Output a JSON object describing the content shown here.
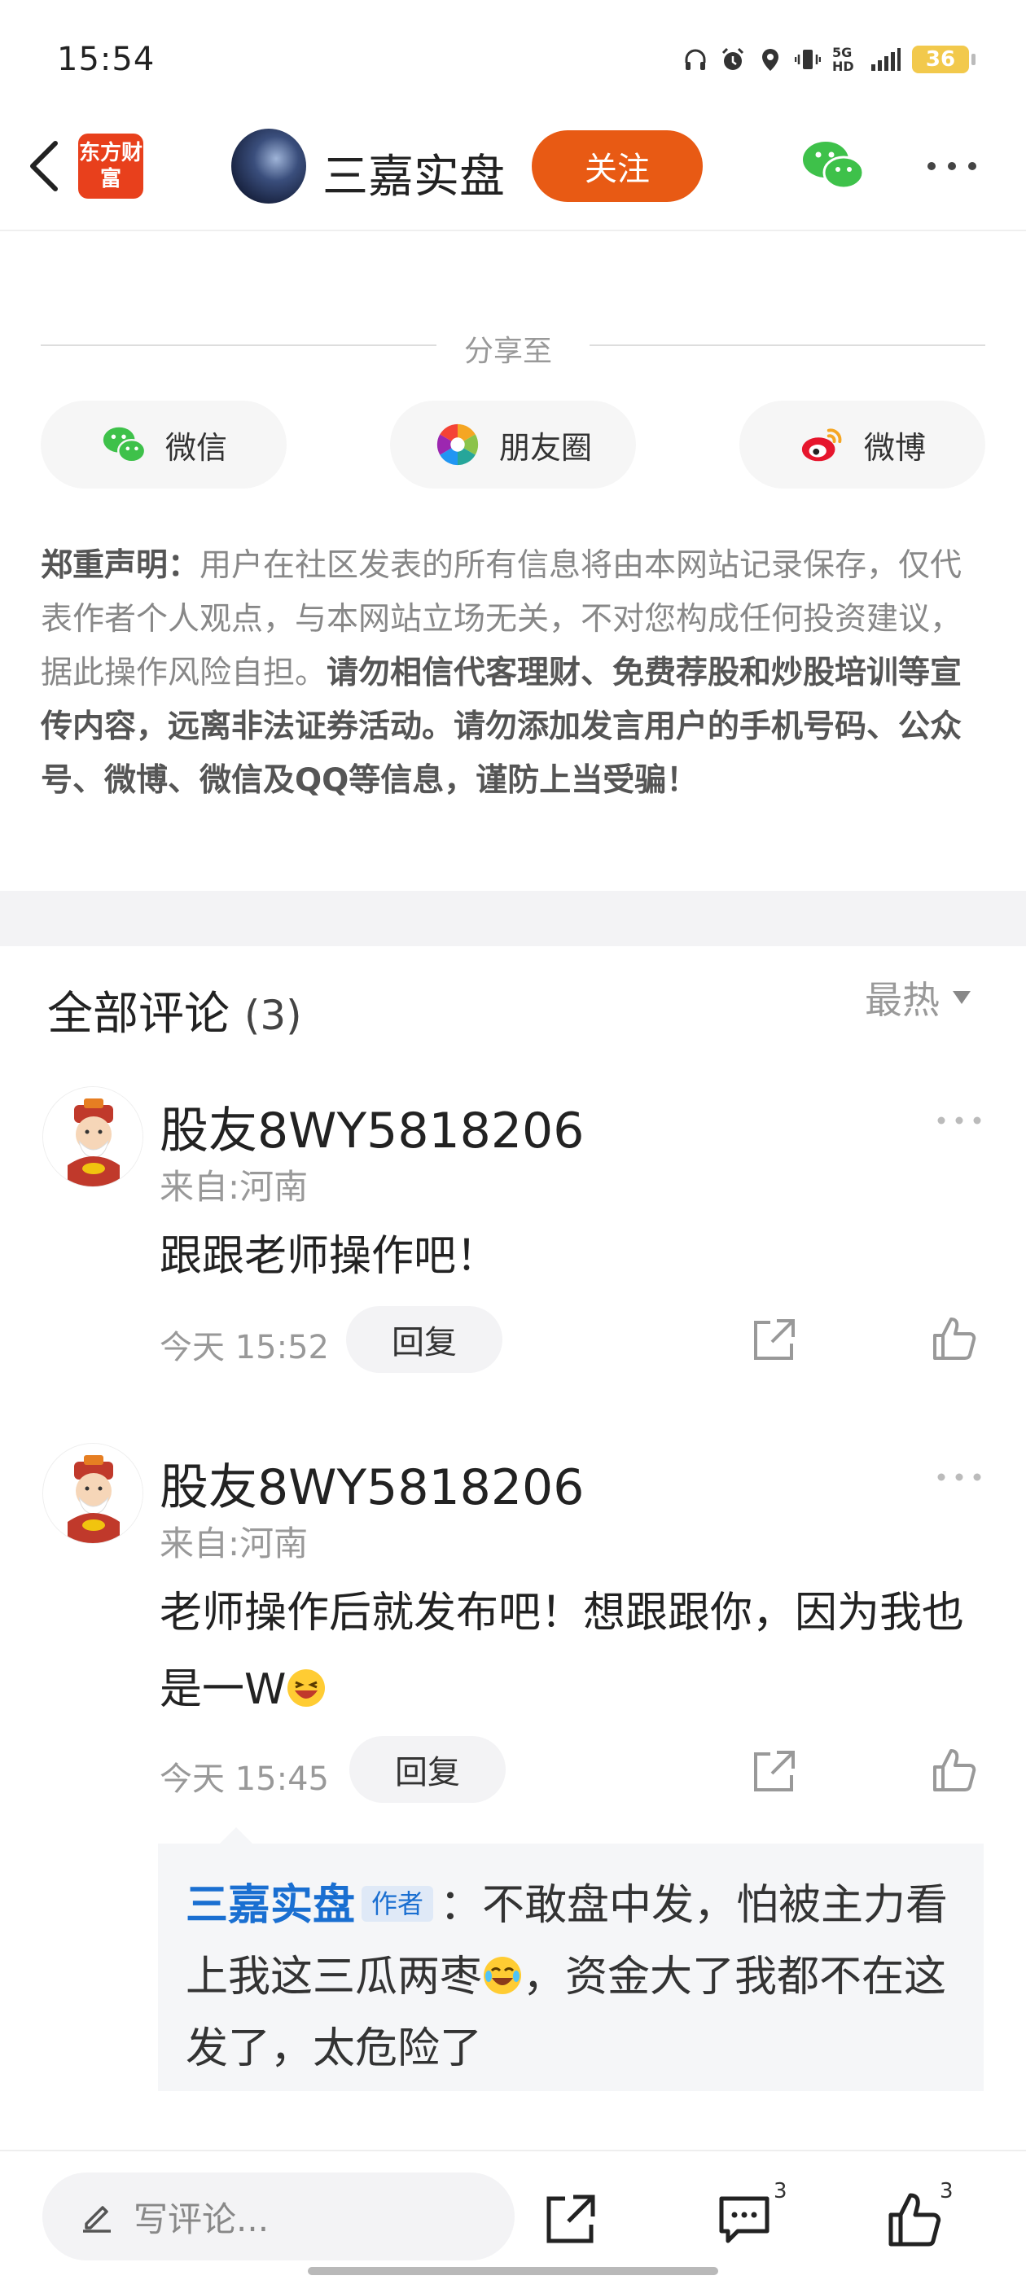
{
  "status_bar": {
    "time": "15:54",
    "network": "5G HD",
    "battery": "36"
  },
  "header": {
    "app_logo_text": "东方财富",
    "author_name": "三嘉实盘",
    "follow_label": "关注"
  },
  "share": {
    "title": "分享至",
    "buttons": [
      {
        "label": "微信",
        "icon": "wechat-icon"
      },
      {
        "label": "朋友圈",
        "icon": "moments-icon"
      },
      {
        "label": "微博",
        "icon": "weibo-icon"
      }
    ]
  },
  "disclaimer": {
    "prefix": "郑重声明：",
    "normal": "用户在社区发表的所有信息将由本网站记录保存，仅代表作者个人观点，与本网站立场无关，不对您构成任何投资建议，据此操作风险自担。",
    "bold": "请勿相信代客理财、免费荐股和炒股培训等宣传内容，远离非法证券活动。请勿添加发言用户的手机号码、公众号、微博、微信及QQ等信息，谨防上当受骗！"
  },
  "comments_section": {
    "title": "全部评论",
    "count": "(3)",
    "sort_label": "最热",
    "reply_label": "回复",
    "comments": [
      {
        "user": "股友8WY5818206",
        "location": "来自:河南",
        "text": "跟跟老师操作吧！",
        "time": "今天 15:52"
      },
      {
        "user": "股友8WY5818206",
        "location": "来自:河南",
        "text": "老师操作后就发布吧！想跟跟你，因为我也是一W",
        "time": "今天 15:45",
        "reply": {
          "author": "三嘉实盘",
          "tag": "作者",
          "text_before": "：不敢盘中发，怕被主力看上我这三瓜两枣",
          "text_after": "，资金大了我都不在这发了，太危险了"
        }
      }
    ]
  },
  "bottom_bar": {
    "input_placeholder": "写评论...",
    "comment_count": "3",
    "like_count": "3"
  }
}
